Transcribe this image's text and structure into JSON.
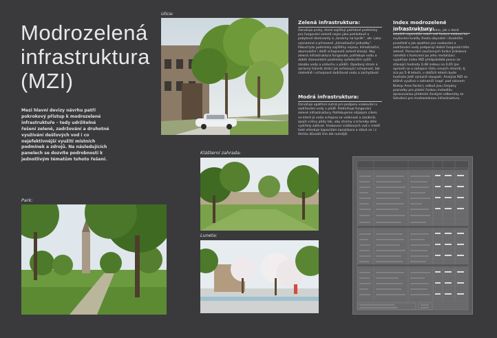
{
  "title": "Modrozelená\ninfrastruktura\n(MZI)",
  "intro": "Mezi hlavní devizy návrhu patří pokrokový přístup k modrozelené infrastruktuře – tedy udržitelné řešení zeleně, zadržování a druhotné využívání dešťových vod i co nejefektivnější využití místních podmínek a zdrojů. Na následujících panelech se dozvíte podrobnosti k jednotlivým tématům tohoto řešení.",
  "captions": {
    "ulice": "Ulice:",
    "park": "Park:",
    "klasterni": "Klášterní zahrada:",
    "luneta": "Luneta:"
  },
  "zelena": {
    "heading": "Zelená infrastruktura:",
    "text": "Označuje prvky, které zajišťují potřebné podmínky pro fungování zeleně nejen jako pohledové a pobytové dominanty a „továrny na kyslík“, ale i jako významné a přirozené „klimatizační jednotky“. Pokud tyto podmínky zajištěny nejsou, klimatizační, akumulační i další schopnosti zeleně klesají. Aby zelená infrastruktura fungovala, potřebuje vodu a dobře stanovitelní podmínky (především vyšší zásobu vody a vzduchu v půdě). Opadaný strom a správný trávník ztrácí jak ochlazující schopnost, tak následně i schopnost zadržovat vodu a zachytávat."
  },
  "modra": {
    "heading": "Modrá infrastruktura:",
    "text": "Označuje opatření nutná pro podporu vsakování a zadržování vody v půdě. Podmiňuje fungování zelené infrastruktury. Potřebujeme nějakým cílem, ve které je voda schopna se vsáknout a zasáknit, spojit vrstvy půdy tak, aby stromy a trávníky déle vydržely zalévat. Vsakovací srážkových vod v místě také ohleduje kapacitám kanalizace a stává se i z těchto důvodů čím dál nutnější."
  },
  "index": {
    "heading": "Index modrozelené infrastruktury:",
    "text": "Jde o souhrnné vyjádření toho, jak v dané lokalitě napomůže zeleň své funkce vedoucí ke zvyšování kvality života obyvatel i životního prostředí a jak opatření pro vsakování a zadržování vody podporují dobré fungování této zeleně. Porovnání současných funkcí Jiráskova náměstí s funkcemi po jeho revitalizaci vyjadřuje index MZI předpokládá posun ze stávající hodnoty 0,48 indexu na 0,65 (po úpravě) se a zahajení růstu nových stromů, tj. zca po 5–8 letech, v dalších letech bude hodnota jistě výrazně stoupat). Analýza MZI se běžně využívá v zahraničí (např. pod názvem Biotop Area Factor), odkud jsou čerpány poznatky pro pilotní českou metodiku zpracovanou předními českými odborníky ze Sdružení pro modrozelenou infrastrukturu."
  },
  "sheet": {
    "header_left": "Souhrn modrozelené infrastruktury s výpočtem",
    "header_right": "Hodnocení současného a budoucího stavu",
    "col_labels": [
      "Název prvku",
      "Jednotka",
      "Výpočet plochy",
      "Souč.",
      "Bud."
    ],
    "total_label": "Index MZI současný stav",
    "total_label_2": "Index MZI navrhovaný stav",
    "total_values": [
      "0,48",
      "0,65"
    ],
    "section_rows": [
      "A. ZELEŇ",
      "B. VODA",
      "C. PROPUSTNÉ PLOCHY"
    ]
  },
  "colors": {
    "background": "#3a3a3c",
    "text": "#e6e6e6",
    "grass": "#6c9a3f",
    "sky": "#dfe6ec"
  }
}
